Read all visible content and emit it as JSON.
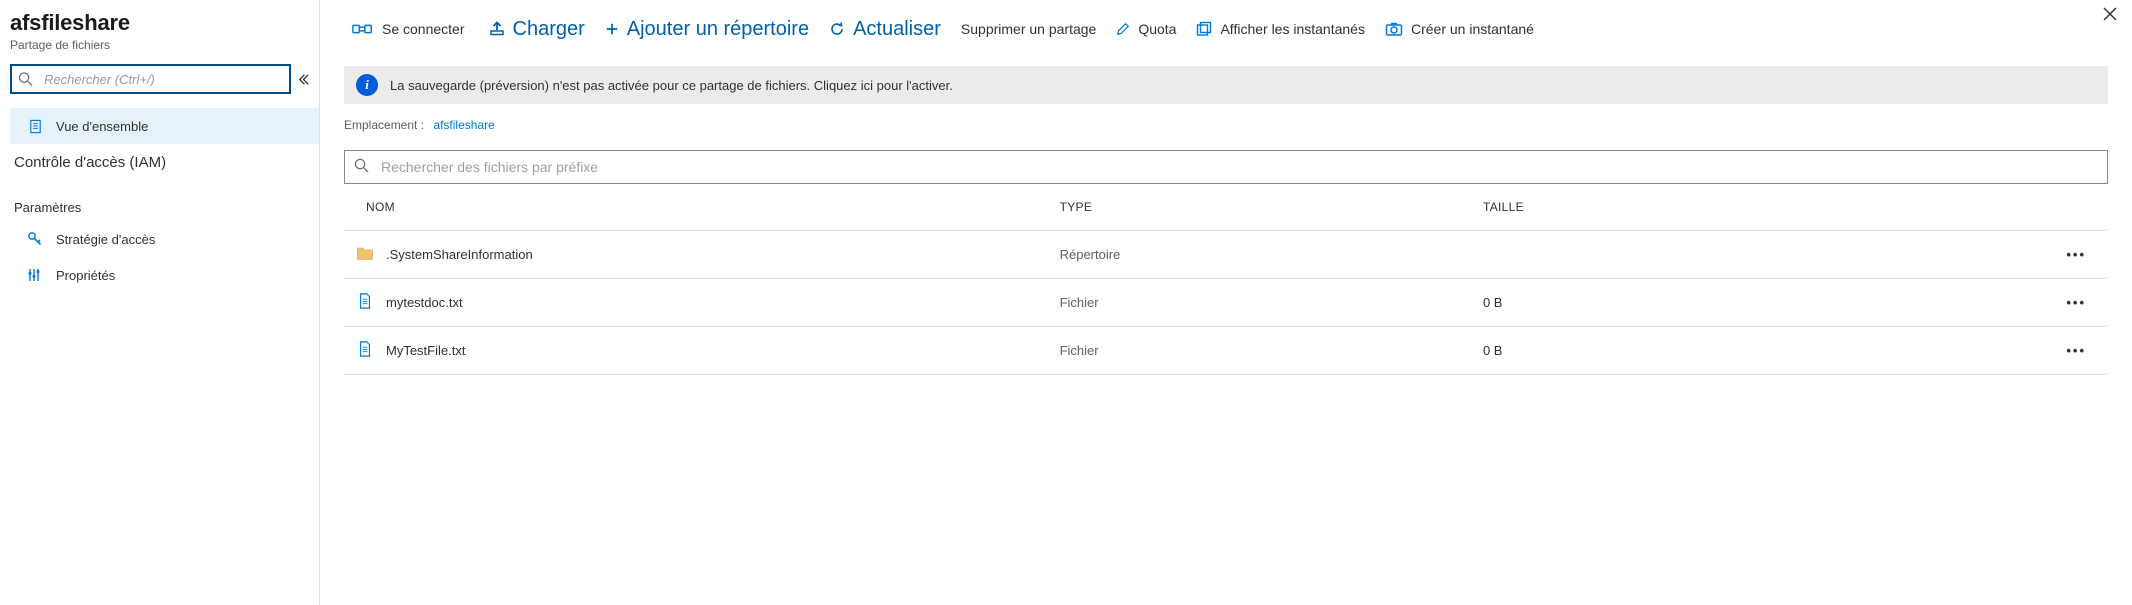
{
  "header": {
    "title": "afsfileshare",
    "subtitle": "Partage de fichiers"
  },
  "sidebar": {
    "search_placeholder": "Rechercher (Ctrl+/)",
    "overview": "Vue d'ensemble",
    "iam": "Contrôle d'accès (IAM)",
    "settings_head": "Paramètres",
    "access_policy": "Stratégie d'accès",
    "properties": "Propriétés"
  },
  "toolbar": {
    "connect": "Se connecter",
    "upload": "Charger",
    "add_dir": "Ajouter un répertoire",
    "refresh": "Actualiser",
    "delete_share": "Supprimer un partage",
    "quota": "Quota",
    "view_snaps": "Afficher les instantanés",
    "create_snap": "Créer un instantané"
  },
  "info": {
    "text": "La sauvegarde (préversion) n'est pas activée pour ce partage de fichiers. Cliquez ici pour l'activer."
  },
  "breadcrumb": {
    "label": "Emplacement :",
    "value": "afsfileshare"
  },
  "files": {
    "search_placeholder": "Rechercher des fichiers par préfixe",
    "col_name": "NOM",
    "col_type": "TYPE",
    "col_size": "TAILLE",
    "rows": [
      {
        "name": ".SystemShareInformation",
        "type": "Répertoire",
        "size": "",
        "kind": "dir"
      },
      {
        "name": "mytestdoc.txt",
        "type": "Fichier",
        "size": "0 B",
        "kind": "file"
      },
      {
        "name": "MyTestFile.txt",
        "type": "Fichier",
        "size": "0 B",
        "kind": "file"
      }
    ]
  }
}
